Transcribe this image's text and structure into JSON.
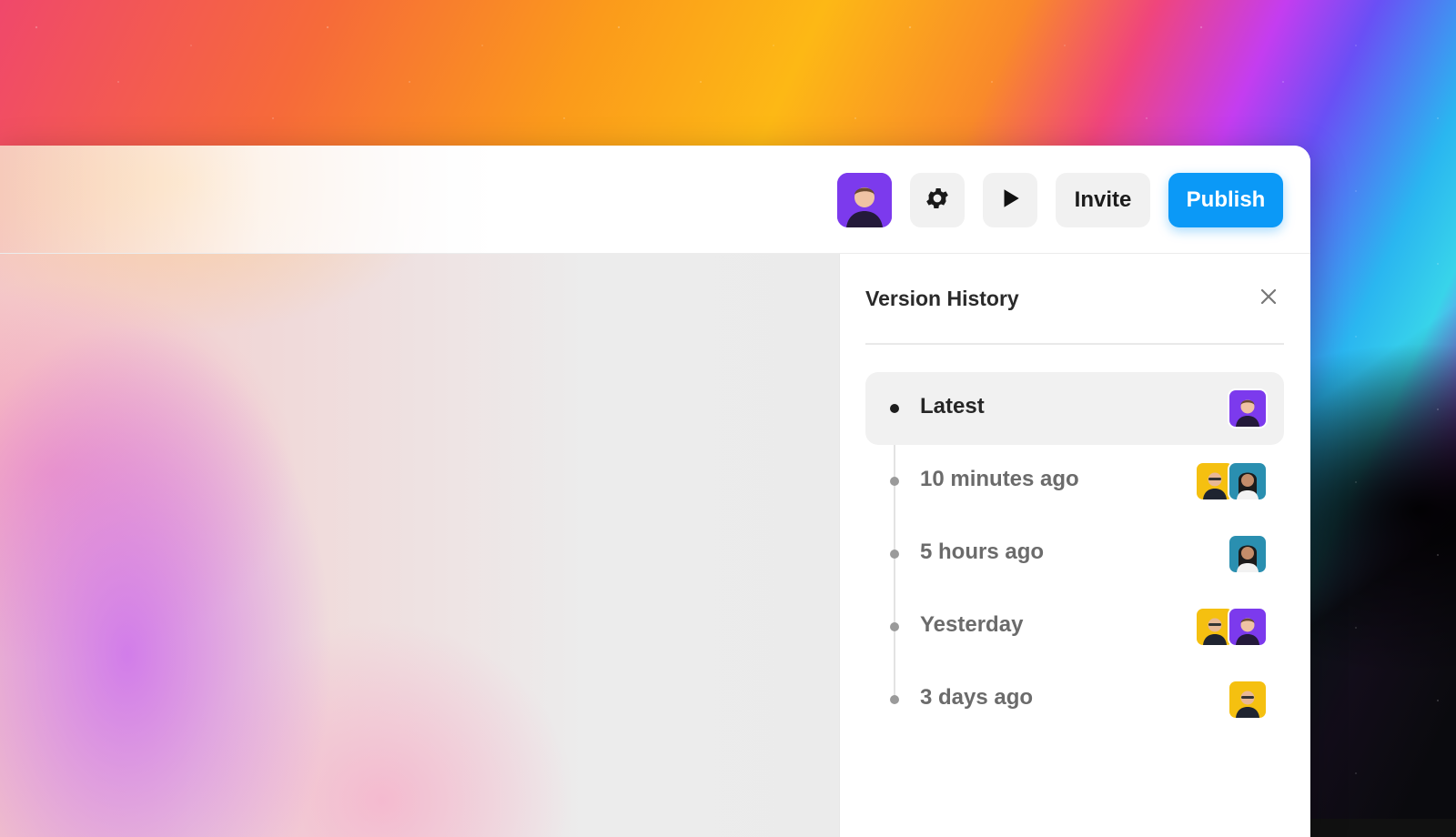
{
  "toolbar": {
    "avatar_icon": "user-avatar-icon",
    "settings_icon": "gear-icon",
    "play_icon": "play-icon",
    "invite_label": "Invite",
    "publish_label": "Publish",
    "publish_color": "#0b99f7"
  },
  "version_history": {
    "title": "Version History",
    "close_icon": "close-icon",
    "items": [
      {
        "label": "Latest",
        "active": true,
        "avatars": [
          "purple-user"
        ]
      },
      {
        "label": "10 minutes ago",
        "active": false,
        "avatars": [
          "yellow-user",
          "teal-user"
        ]
      },
      {
        "label": "5 hours ago",
        "active": false,
        "avatars": [
          "teal-user"
        ]
      },
      {
        "label": "Yesterday",
        "active": false,
        "avatars": [
          "yellow-user",
          "purple-user"
        ]
      },
      {
        "label": "3 days ago",
        "active": false,
        "avatars": [
          "yellow-user"
        ]
      }
    ]
  },
  "colors": {
    "avatar_purple": "#7c3aed",
    "avatar_yellow": "#f5c010",
    "avatar_teal": "#2a8fb0"
  }
}
